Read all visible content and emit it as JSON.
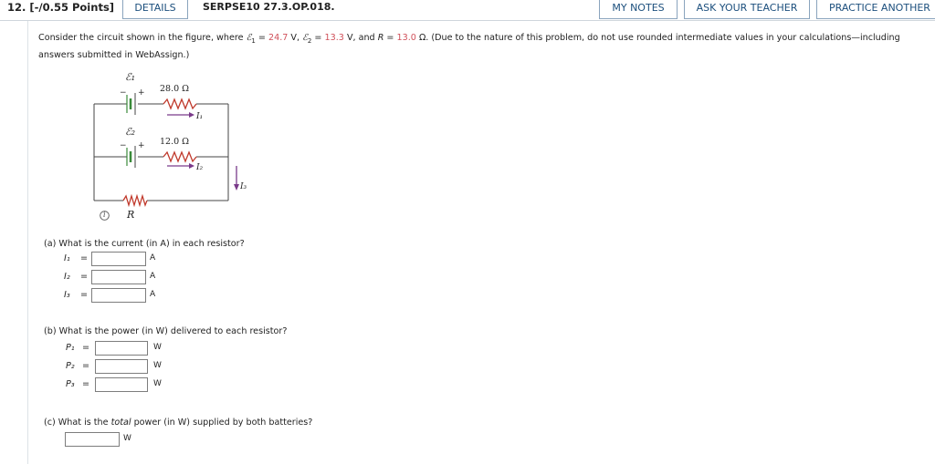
{
  "header": {
    "question_number": "12. [-/0.55 Points]",
    "details_label": "DETAILS",
    "code": "SERPSE10 27.3.OP.018.",
    "my_notes_label": "MY NOTES",
    "ask_teacher_label": "ASK YOUR TEACHER",
    "practice_label": "PRACTICE ANOTHER"
  },
  "prompt": {
    "p1": "Consider the circuit shown in the figure, where ",
    "emf1_sym": "ℰ",
    "emf1_sub": "1",
    "eq1": " = ",
    "emf1_val": "24.7",
    "unit1": " V, ",
    "emf2_sym": "ℰ",
    "emf2_sub": "2",
    "eq2": " = ",
    "emf2_val": "13.3",
    "unit2": " V, and ",
    "r_sym": "R",
    "eq3": " = ",
    "r_val": "13.0",
    "unit3": " Ω. (Due to the nature of this problem, do not use rounded intermediate values in your calculations—including answers submitted in WebAssign.)"
  },
  "figure": {
    "emf1_label": "ℰ₁",
    "emf2_label": "ℰ₂",
    "plus1": "+",
    "minus1": "−",
    "plus2": "+",
    "minus2": "−",
    "r1_label": "28.0 Ω",
    "r2_label": "12.0 Ω",
    "i1_label": "I₁",
    "i2_label": "I₂",
    "i3_label": "I₃",
    "r_label": "R",
    "info_icon": "i"
  },
  "part_a": {
    "question": "(a)   What is the current (in A) in each resistor?",
    "rows": [
      {
        "label": "I₁",
        "eq": "=",
        "value": "",
        "unit": "A"
      },
      {
        "label": "I₂",
        "eq": "=",
        "value": "",
        "unit": "A"
      },
      {
        "label": "I₃",
        "eq": "=",
        "value": "",
        "unit": "A"
      }
    ]
  },
  "part_b": {
    "question": "(b)   What is the power (in W) delivered to each resistor?",
    "rows": [
      {
        "label": "P₁",
        "eq": "=",
        "value": "",
        "unit": "W"
      },
      {
        "label": "P₂",
        "eq": "=",
        "value": "",
        "unit": "W"
      },
      {
        "label": "P₃",
        "eq": "=",
        "value": "",
        "unit": "W"
      }
    ]
  },
  "part_c": {
    "q_pre": "(c)   What is the ",
    "q_em": "total",
    "q_post": " power (in W) supplied by both batteries?",
    "value": "",
    "unit": "W"
  },
  "colors": {
    "accent_link": "#1c4f7d",
    "value_red": "#d0505a",
    "resistor_red": "#c0392b",
    "battery_green": "#3a8a3a"
  }
}
